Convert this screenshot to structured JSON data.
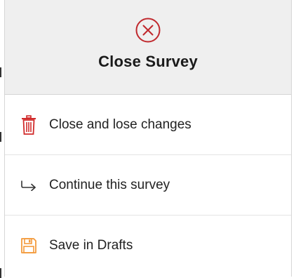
{
  "dialog": {
    "title": "Close Survey",
    "header_icon": "close-circle-icon",
    "accent_color": "#c0282d"
  },
  "actions": [
    {
      "label": "Close and lose changes",
      "icon": "trash-icon",
      "color": "#d12b2b"
    },
    {
      "label": "Continue this survey",
      "icon": "arrow-return-right-icon",
      "color": "#333333"
    },
    {
      "label": "Save in Drafts",
      "icon": "save-drafts-icon",
      "color": "#f39a3b"
    }
  ]
}
